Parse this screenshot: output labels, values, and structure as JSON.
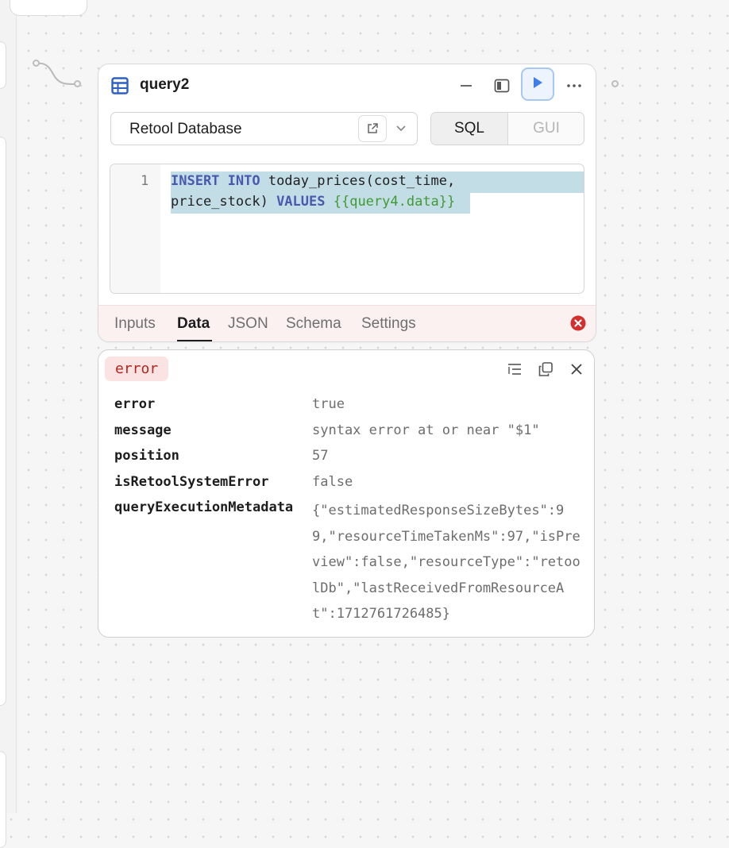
{
  "query": {
    "name": "query2",
    "resource": "Retool Database",
    "mode_tabs": {
      "sql": "SQL",
      "gui": "GUI",
      "active": "SQL"
    },
    "editor": {
      "line_number": "1",
      "line1": {
        "kw": "INSERT INTO",
        "rest": " today_prices(cost_time,"
      },
      "line2": {
        "text": "price_stock) ",
        "kw": "VALUES",
        "space": " ",
        "template": "{{query4.data}}"
      }
    },
    "tabs": [
      {
        "label": "Inputs"
      },
      {
        "label": "Data"
      },
      {
        "label": "JSON"
      },
      {
        "label": "Schema"
      },
      {
        "label": "Settings"
      }
    ],
    "active_tab": "Data",
    "status": "error"
  },
  "result": {
    "badge": "error",
    "rows": [
      {
        "key": "error",
        "value": "true"
      },
      {
        "key": "message",
        "value": "syntax error at or near \"$1\""
      },
      {
        "key": "position",
        "value": "57"
      },
      {
        "key": "isRetoolSystemError",
        "value": "false"
      },
      {
        "key": "queryExecutionMetadata",
        "value": "{\"estimatedResponseSizeBytes\":99,\"resourceTimeTakenMs\":97,\"isPreview\":false,\"resourceType\":\"retoolDb\",\"lastReceivedFromResourceAt\":1712761726485}"
      }
    ]
  },
  "icons": {
    "header": [
      "table-icon",
      "minimize-icon",
      "sidebar-panel-icon",
      "run-icon",
      "more-icon"
    ],
    "resource": [
      "external-link-icon",
      "chevron-down-icon"
    ],
    "result": [
      "list-format-icon",
      "copy-icon",
      "close-icon"
    ],
    "status": "error-circle-icon"
  },
  "colors": {
    "accent": "#3d7ee8",
    "keyword": "#4a58ae",
    "template": "#3f9b32",
    "selection": "#c2dde6",
    "error": "#d32f2f",
    "error_badge_bg": "#fbe3e3"
  }
}
